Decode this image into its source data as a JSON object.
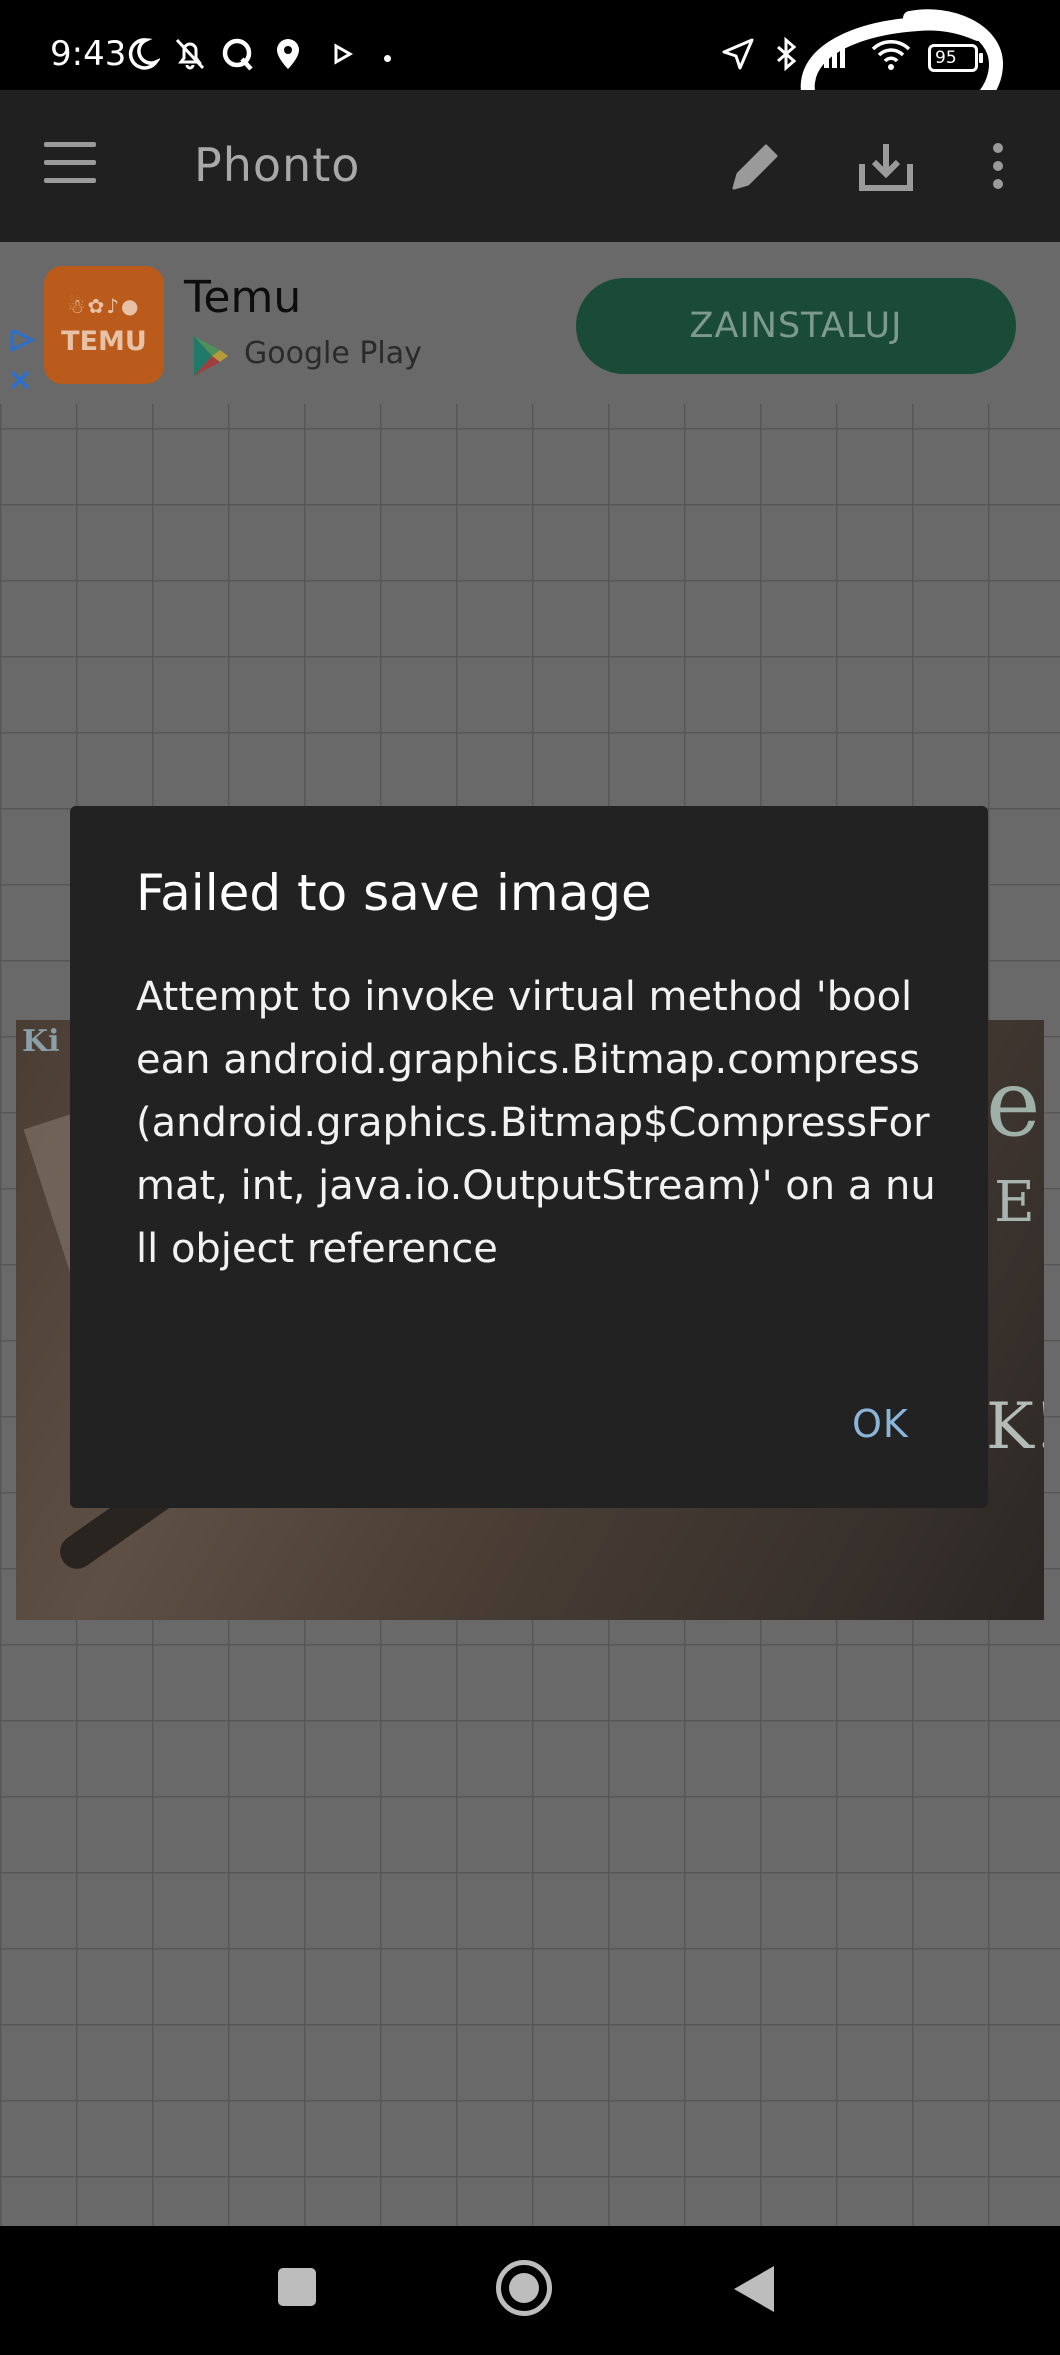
{
  "status_bar": {
    "time": "9:43",
    "battery_level": "95",
    "icons": [
      "moon-icon",
      "bell-off-icon",
      "q-icon",
      "location-pin-icon",
      "play-icon",
      "navigation-icon",
      "bluetooth-icon",
      "signal-icon",
      "wifi-icon",
      "battery-icon"
    ]
  },
  "app_bar": {
    "title": "Phonto",
    "actions": [
      "edit-pencil-icon",
      "download-icon",
      "more-vert-icon"
    ]
  },
  "ad": {
    "app_name": "Temu",
    "store": "Google Play",
    "logo_text": "TEMU",
    "install_label": "ZAINSTALUJ",
    "colors": {
      "install_bg": "#1a4a38",
      "logo_bg": "#ba5a1b"
    }
  },
  "dialog": {
    "title": "Failed to save image",
    "message": "Attempt to invoke virtual method 'boolean android.graphics.Bitmap.compress(android.graphics.Bitmap$CompressFormat, int, java.io.OutputStream)' on a null object reference",
    "ok_label": "OK"
  },
  "nav_bar": {
    "buttons": [
      "recent-apps-icon",
      "home-icon",
      "back-icon"
    ]
  }
}
